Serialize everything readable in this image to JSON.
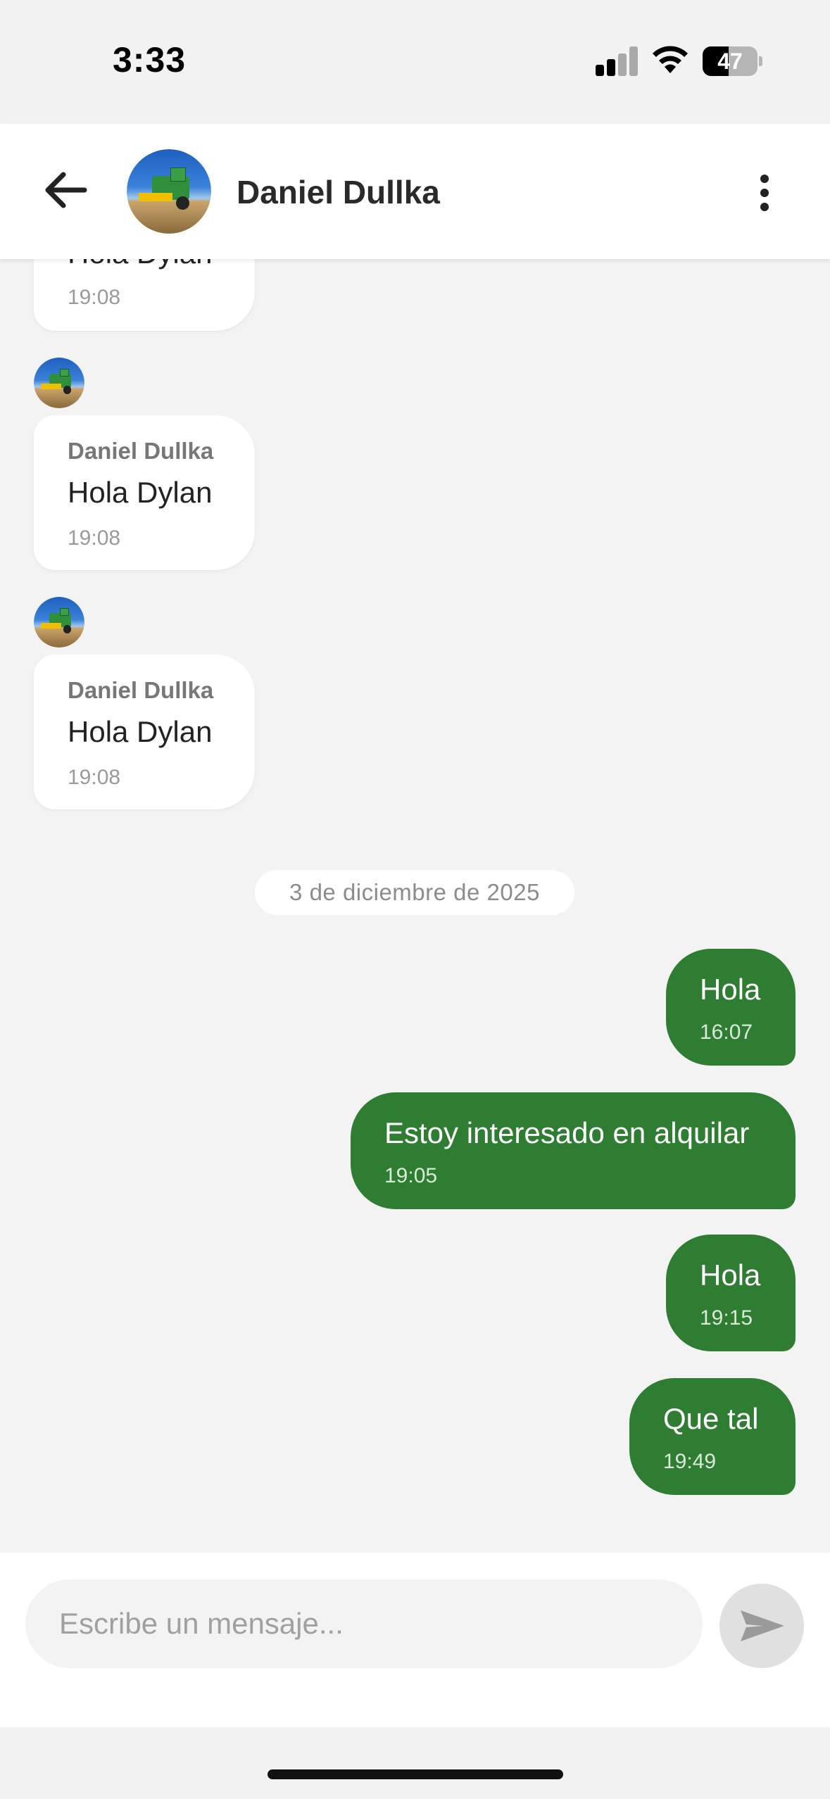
{
  "status_bar": {
    "time": "3:33",
    "battery": "47",
    "battery_level": 0.47,
    "icons": [
      "cellular-signal-icon",
      "wifi-icon",
      "battery-icon"
    ]
  },
  "header": {
    "contact_name": "Daniel Dullka",
    "back_icon": "arrow-left-icon",
    "avatar": "harvester-photo",
    "menu_icon": "more-vertical-icon"
  },
  "incoming_messages": [
    {
      "text": "Hola Dylan",
      "time": "19:08"
    },
    {
      "sender": "Daniel Dullka",
      "text": "Hola Dylan",
      "time": "19:08"
    },
    {
      "sender": "Daniel Dullka",
      "text": "Hola Dylan",
      "time": "19:08"
    }
  ],
  "date_separator": "3 de diciembre de 2025",
  "outgoing_messages": [
    {
      "text": "Hola",
      "time": "16:07"
    },
    {
      "text": "Estoy interesado en alquilar",
      "time": "19:05"
    },
    {
      "text": "Hola",
      "time": "19:15"
    },
    {
      "text": "Que tal",
      "time": "19:49"
    }
  ],
  "composer": {
    "placeholder": "Escribe un mensaje...",
    "value": "",
    "send_icon": "send-icon"
  },
  "colors": {
    "accent": "#2e7d32",
    "background": "#f3f3f3",
    "bubble_incoming": "#ffffff",
    "send_disabled": "#e0e0e0"
  }
}
